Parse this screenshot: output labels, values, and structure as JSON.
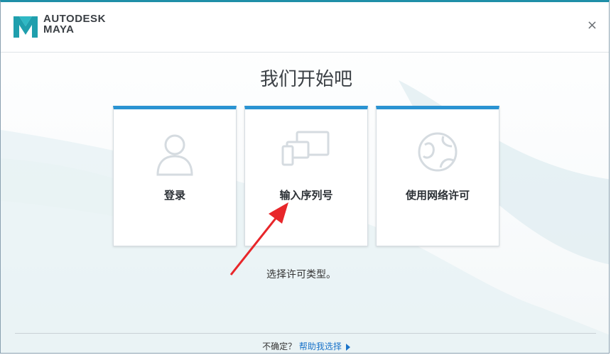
{
  "header": {
    "brand_line1": "AUTODESK",
    "brand_line2": "MAYA",
    "close_label": "×"
  },
  "main": {
    "title": "我们开始吧",
    "cards": [
      {
        "label": "登录",
        "icon": "user-icon"
      },
      {
        "label": "输入序列号",
        "icon": "devices-icon"
      },
      {
        "label": "使用网络许可",
        "icon": "globe-icon"
      }
    ],
    "hint": "选择许可类型。"
  },
  "footer": {
    "prefix": "不确定？",
    "link": "帮助我选择"
  },
  "colors": {
    "accent": "#2a93d2",
    "title_bar": "#1f8fa8",
    "link": "#1a73c9",
    "arrow": "#e8262a"
  }
}
